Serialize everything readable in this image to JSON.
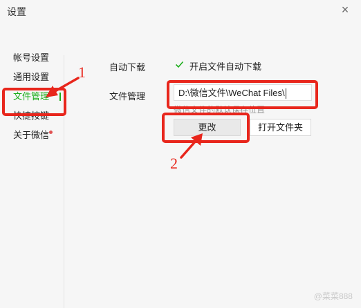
{
  "window": {
    "title": "设置",
    "close_glyph": "×"
  },
  "sidebar": {
    "items": [
      {
        "label": "帐号设置"
      },
      {
        "label": "通用设置"
      },
      {
        "label": "文件管理",
        "active": true
      },
      {
        "label": "快捷按键"
      },
      {
        "label": "关于微信",
        "badge": "red-dot"
      }
    ]
  },
  "main": {
    "auto_download": {
      "label": "自动下载",
      "checkbox_label": "开启文件自动下载",
      "checked": true
    },
    "file_manage": {
      "label": "文件管理",
      "path_value": "D:\\微信文件\\WeChat Files\\",
      "hint": "微信文件的默认保存位置",
      "change_button": "更改",
      "open_folder_button": "打开文件夹"
    }
  },
  "annotations": {
    "marker_1": "1",
    "marker_2": "2",
    "color": "#e8261c"
  },
  "watermark": "@菜菜888",
  "colors": {
    "accent": "#1aad19",
    "annotation": "#e8261c",
    "badge": "#e05252"
  }
}
